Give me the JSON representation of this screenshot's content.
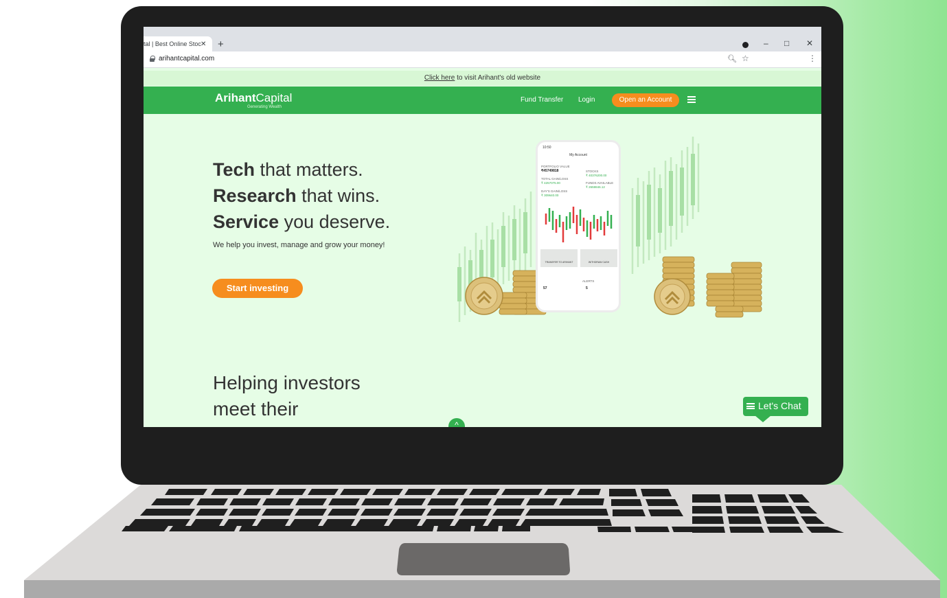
{
  "browser": {
    "tab_title": "tal | Best Online Stoc",
    "tab_close": "✕",
    "new_tab": "+",
    "url": "arihantcapital.com",
    "window_controls": [
      "–",
      "□",
      "✕"
    ]
  },
  "site": {
    "notice": {
      "link": "Click here",
      "text": " to visit Arihant's old website"
    },
    "logo": {
      "bold": "Arihant",
      "light": "Capital",
      "tagline": "Generating Wealth"
    },
    "nav": {
      "fund_transfer": "Fund Transfer",
      "login": "Login",
      "open_account": "Open an Account"
    },
    "hero": {
      "line1_bold": "Tech",
      "line1_rest": " that matters.",
      "line2_bold": "Research",
      "line2_rest": " that wins.",
      "line3_bold": "Service",
      "line3_rest": " you deserve.",
      "subtitle": "We help you invest, manage and grow your money!",
      "cta": "Start investing"
    },
    "helping": {
      "line1": "Helping investors",
      "line2": "meet their"
    },
    "chat": "Let's Chat"
  },
  "phone": {
    "time": "10:50",
    "title": "My Account",
    "portfolio_label": "PORTFOLIO VALUE",
    "portfolio_value": "₹45749818",
    "stocks_label": "STOCKS",
    "stocks_value": "₹ 40376200.00",
    "gain_label": "TOTAL GAIN/LOSS",
    "gain_value": "₹ 4257075.00",
    "funds_label": "FUNDS AVAILABLE",
    "funds_value": "₹ 2659846.12",
    "days_label": "DAY'S GAIN/LOSS",
    "days_value": "₹ 309640.00",
    "btn_transfer": "TRANSFER TO ARIHANT",
    "btn_withdraw": "WITHDRAW CASH",
    "alerts_label": "ALERTS",
    "alerts_value": "5",
    "other_value": "57"
  },
  "colors": {
    "brand_green": "#34b050",
    "accent_orange": "#f68d1e",
    "page_bg": "#e6fde6"
  }
}
